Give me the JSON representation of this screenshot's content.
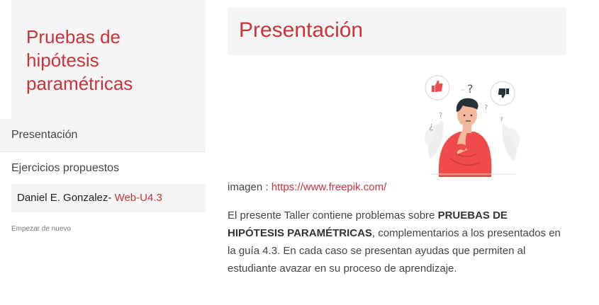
{
  "sidebar": {
    "book_title": "Pruebas de hipótesis paramétricas",
    "nav": [
      {
        "label": "Presentación"
      },
      {
        "label": "Ejercicios propuestos"
      }
    ],
    "author": {
      "name": "Daniel E. Gonzalez-",
      "link_text": "Web-U4.3"
    },
    "restart_label": "Empezar de nuevo"
  },
  "main": {
    "title": "Presentación",
    "illustration": {
      "name": "thinking-person-illustration",
      "accent_color": "#ef4b4b",
      "icons": [
        "thumbs-up-icon",
        "thumbs-down-icon",
        "question-mark-icon"
      ]
    },
    "caption": {
      "prefix": "imagen :",
      "link": "https://www.freepik.com/"
    },
    "paragraph": {
      "intro": "El presente Taller contiene problemas sobre",
      "bold": "PRUEBAS DE HIPÓTESIS PARAMÉTRICAS",
      "rest": ", complementarios a los presentados en la guía 4.3. En cada caso se presentan ayudas que permiten al estudiante avazar en su proceso de aprendizaje."
    }
  },
  "colors": {
    "accent": "#c7343a",
    "panel": "#f5f5f5",
    "text": "#444444"
  }
}
